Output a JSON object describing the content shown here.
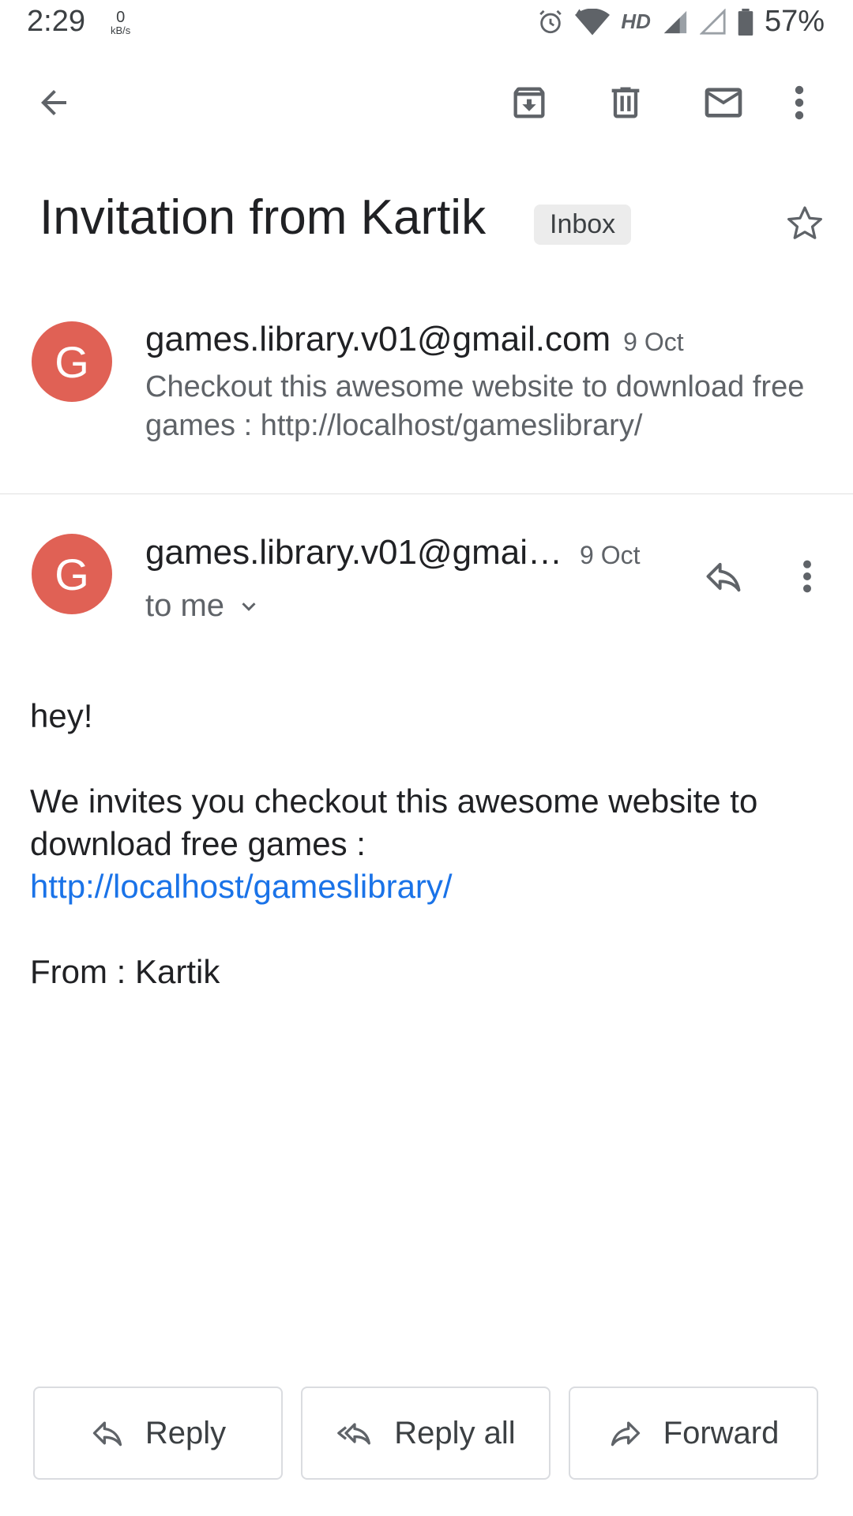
{
  "status_bar": {
    "time": "2:29",
    "net_speed_value": "0",
    "net_speed_unit": "kB/s",
    "network_label": "HD",
    "battery_percent": "57%"
  },
  "app_bar": {
    "icons": [
      "back-arrow-icon",
      "archive-icon",
      "delete-icon",
      "mark-unread-icon",
      "more-vert-icon"
    ]
  },
  "subject": {
    "title": "Invitation from Kartik",
    "label": "Inbox"
  },
  "thread": [
    {
      "avatar_letter": "G",
      "sender": "games.library.v01@gmail.com",
      "date": "9 Oct",
      "snippet": "Checkout this awesome website to download free games : http://localhost/gameslibrary/"
    },
    {
      "avatar_letter": "G",
      "sender": "games.library.v01@gmai…",
      "date": "9 Oct",
      "recipient": "to me",
      "body": {
        "greeting": "hey!",
        "line1": "We invites you checkout this awesome website to download free games :",
        "link": "http://localhost/gameslibrary/",
        "signoff": "From : Kartik"
      }
    }
  ],
  "actions": {
    "reply": "Reply",
    "reply_all": "Reply all",
    "forward": "Forward"
  },
  "colors": {
    "avatar": "#e06155",
    "link": "#1a73e8",
    "icon": "#5f6368"
  }
}
